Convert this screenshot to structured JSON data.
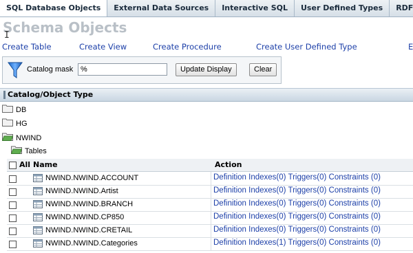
{
  "tabs": [
    {
      "label": "SQL Database Objects",
      "active": true
    },
    {
      "label": "External Data Sources",
      "active": false
    },
    {
      "label": "Interactive SQL",
      "active": false
    },
    {
      "label": "User Defined Types",
      "active": false
    },
    {
      "label": "RDF Vie",
      "active": false
    }
  ],
  "page_title": "Schema Objects",
  "actions": [
    "Create Table",
    "Create View",
    "Create Procedure",
    "Create User Defined Type",
    "E"
  ],
  "filter": {
    "label": "Catalog mask",
    "value": "%",
    "update_label": "Update Display",
    "clear_label": "Clear"
  },
  "tree": {
    "header": "Catalog/Object Type",
    "nodes": [
      {
        "label": "DB",
        "expanded": false
      },
      {
        "label": "HG",
        "expanded": false
      },
      {
        "label": "NWIND",
        "expanded": true
      },
      {
        "label": "Tables",
        "expanded": true
      }
    ]
  },
  "table": {
    "all_label": "All",
    "name_header": "Name",
    "action_header": "Action",
    "rows": [
      {
        "name": "NWIND.NWIND.ACCOUNT",
        "definition": "Definition",
        "indexes": "Indexes(0)",
        "triggers": "Triggers(0)",
        "constraints": "Constraints (0)"
      },
      {
        "name": "NWIND.NWIND.Artist",
        "definition": "Definition",
        "indexes": "Indexes(0)",
        "triggers": "Triggers(0)",
        "constraints": "Constraints (0)"
      },
      {
        "name": "NWIND.NWIND.BRANCH",
        "definition": "Definition",
        "indexes": "Indexes(0)",
        "triggers": "Triggers(0)",
        "constraints": "Constraints (0)"
      },
      {
        "name": "NWIND.NWIND.CP850",
        "definition": "Definition",
        "indexes": "Indexes(0)",
        "triggers": "Triggers(0)",
        "constraints": "Constraints (0)"
      },
      {
        "name": "NWIND.NWIND.CRETAIL",
        "definition": "Definition",
        "indexes": "Indexes(0)",
        "triggers": "Triggers(0)",
        "constraints": "Constraints (0)"
      },
      {
        "name": "NWIND.NWIND.Categories",
        "definition": "Definition",
        "indexes": "Indexes(1)",
        "triggers": "Triggers(0)",
        "constraints": "Constraints (0)"
      }
    ]
  },
  "colors": {
    "link": "#1c3fa8",
    "title": "#b9c0c7",
    "tab_bg": "#dde4ea"
  }
}
